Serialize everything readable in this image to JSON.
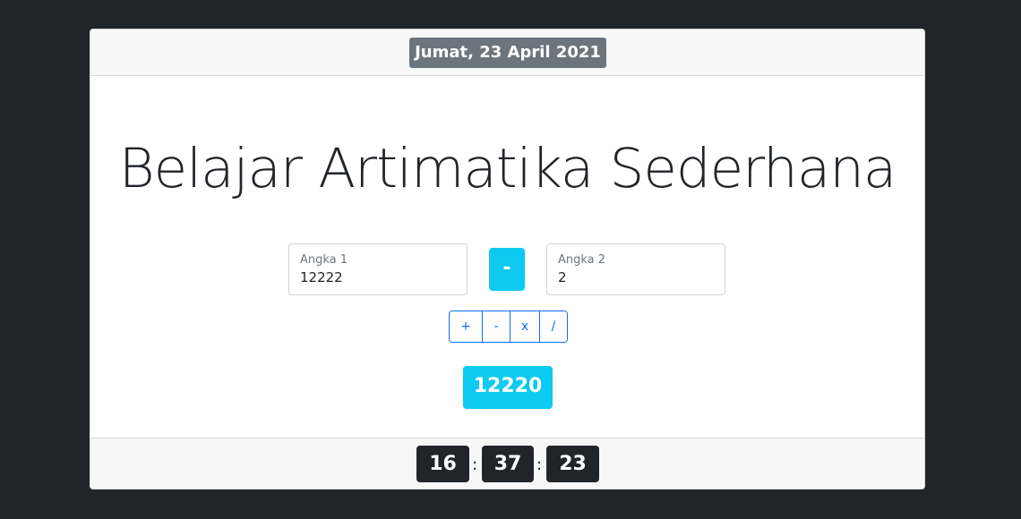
{
  "header": {
    "date": "Jumat, 23 April 2021"
  },
  "main": {
    "title": "Belajar Artimatika Sederhana",
    "input1": {
      "label": "Angka 1",
      "value": "12222"
    },
    "operator": "-",
    "input2": {
      "label": "Angka 2",
      "value": "2"
    },
    "operations": [
      "+",
      "-",
      "x",
      "/"
    ],
    "result": "12220"
  },
  "footer": {
    "clock": {
      "hours": "16",
      "minutes": "37",
      "seconds": "23",
      "separator": ":"
    }
  },
  "colors": {
    "background": "#212529",
    "info": "#0dcaf0",
    "secondary": "#6c757d",
    "primary": "#0d6efd",
    "dark": "#212529"
  }
}
